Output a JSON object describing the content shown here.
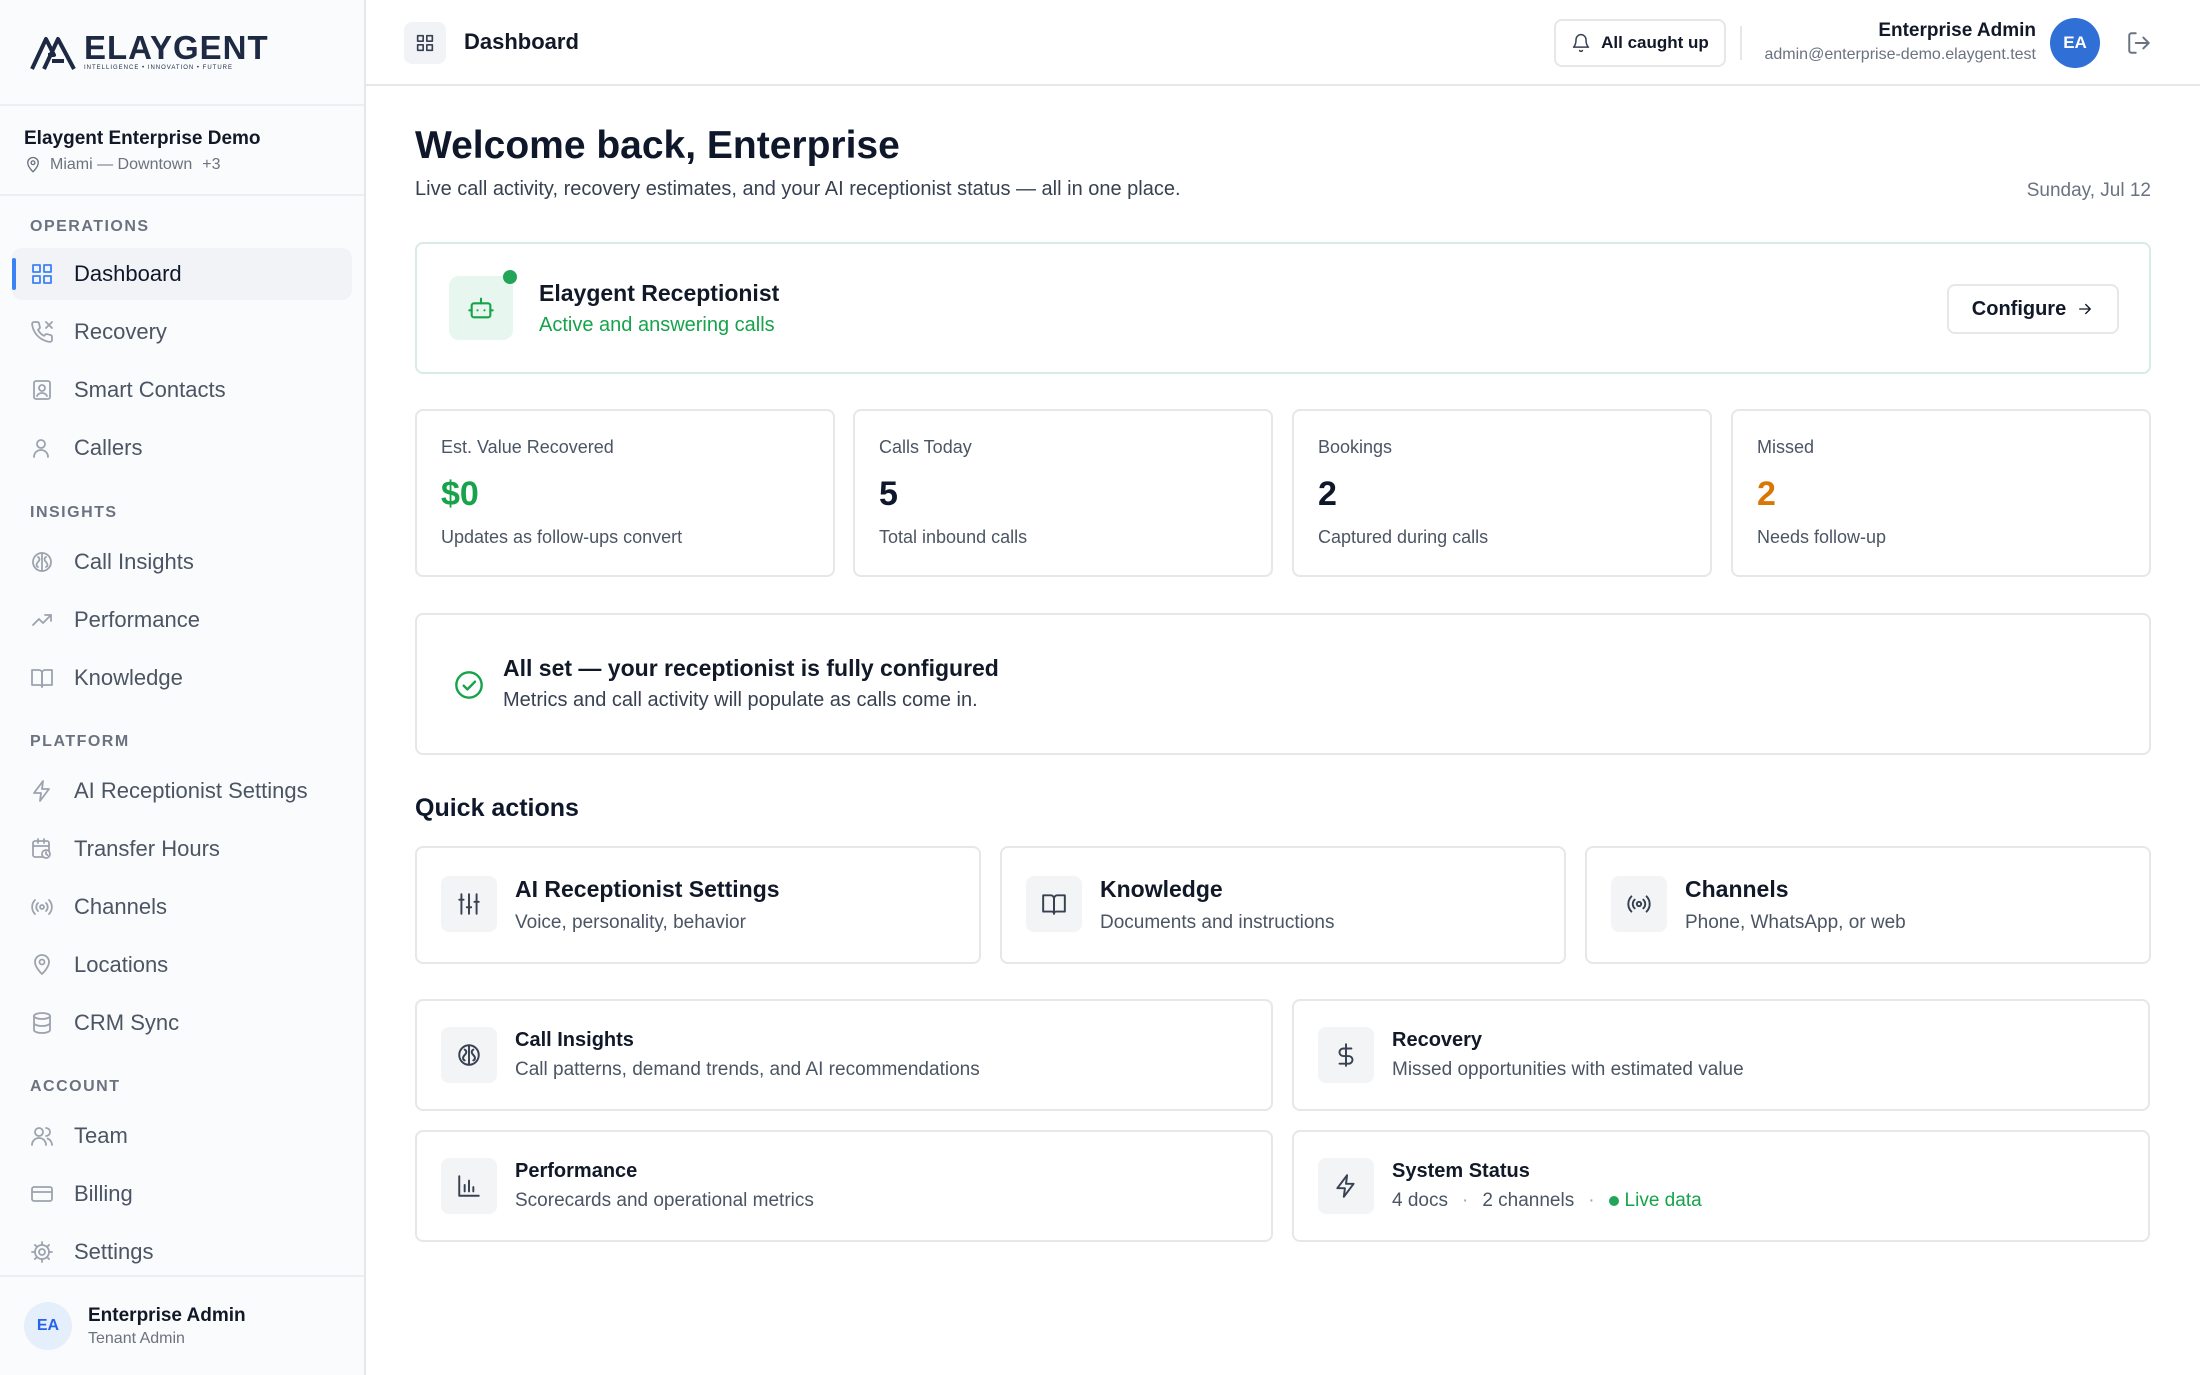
{
  "brand": {
    "name": "ELAYGENT",
    "tagline": "INTELLIGENCE • INNOVATION • FUTURE"
  },
  "org": {
    "name": "Elaygent Enterprise Demo",
    "location": "Miami — Downtown",
    "more": "+3"
  },
  "sidebar": {
    "sections": [
      {
        "label": "OPERATIONS"
      },
      {
        "label": "INSIGHTS"
      },
      {
        "label": "PLATFORM"
      },
      {
        "label": "ACCOUNT"
      }
    ],
    "items": [
      {
        "label": "Dashboard",
        "icon": "grid-icon",
        "active": true
      },
      {
        "label": "Recovery",
        "icon": "phone-missed-icon"
      },
      {
        "label": "Smart Contacts",
        "icon": "contact-card-icon"
      },
      {
        "label": "Callers",
        "icon": "user-icon"
      },
      {
        "label": "Call Insights",
        "icon": "brain-icon"
      },
      {
        "label": "Performance",
        "icon": "trending-up-icon"
      },
      {
        "label": "Knowledge",
        "icon": "book-icon"
      },
      {
        "label": "AI Receptionist Settings",
        "icon": "bolt-icon"
      },
      {
        "label": "Transfer Hours",
        "icon": "calendar-clock-icon"
      },
      {
        "label": "Channels",
        "icon": "broadcast-icon"
      },
      {
        "label": "Locations",
        "icon": "map-pin-icon"
      },
      {
        "label": "CRM Sync",
        "icon": "database-icon"
      },
      {
        "label": "Team",
        "icon": "users-icon"
      },
      {
        "label": "Billing",
        "icon": "credit-card-icon"
      },
      {
        "label": "Settings",
        "icon": "gear-icon"
      }
    ],
    "user": {
      "initials": "EA",
      "name": "Enterprise Admin",
      "role": "Tenant Admin"
    }
  },
  "header": {
    "title": "Dashboard",
    "notifications": "All caught up",
    "user": {
      "name": "Enterprise Admin",
      "email": "admin@enterprise-demo.elaygent.test",
      "initials": "EA"
    }
  },
  "main": {
    "welcome": "Welcome back, Enterprise",
    "subtitle": "Live call activity, recovery estimates, and your AI receptionist status — all in one place.",
    "date": "Sunday, Jul 12",
    "receptionist": {
      "title": "Elaygent Receptionist",
      "status": "Active and answering calls",
      "button": "Configure"
    },
    "stats": [
      {
        "label": "Est. Value Recovered",
        "value": "$0",
        "note": "Updates as follow-ups convert",
        "color": "#16a34a"
      },
      {
        "label": "Calls Today",
        "value": "5",
        "note": "Total inbound calls",
        "color": "#0f172a"
      },
      {
        "label": "Bookings",
        "value": "2",
        "note": "Captured during calls",
        "color": "#0f172a"
      },
      {
        "label": "Missed",
        "value": "2",
        "note": "Needs follow-up",
        "color": "#d97706"
      }
    ],
    "allset": {
      "title": "All set — your receptionist is fully configured",
      "text": "Metrics and call activity will populate as calls come in."
    },
    "quick_actions_title": "Quick actions",
    "quick_actions": [
      {
        "name": "AI Receptionist Settings",
        "desc": "Voice, personality, behavior",
        "icon": "sliders-icon"
      },
      {
        "name": "Knowledge",
        "desc": "Documents and instructions",
        "icon": "book-icon"
      },
      {
        "name": "Channels",
        "desc": "Phone, WhatsApp, or web",
        "icon": "broadcast-icon"
      },
      {
        "name": "Call Insights",
        "desc": "Call patterns, demand trends, and AI recommendations",
        "icon": "brain-icon"
      },
      {
        "name": "Recovery",
        "desc": "Missed opportunities with estimated value",
        "icon": "dollar-icon"
      },
      {
        "name": "Performance",
        "desc": "Scorecards and operational metrics",
        "icon": "bar-chart-icon"
      },
      {
        "name": "System Status",
        "docs": "4 docs",
        "channels": "2 channels",
        "sep": "·",
        "live": "Live data",
        "icon": "bolt-icon"
      }
    ]
  }
}
